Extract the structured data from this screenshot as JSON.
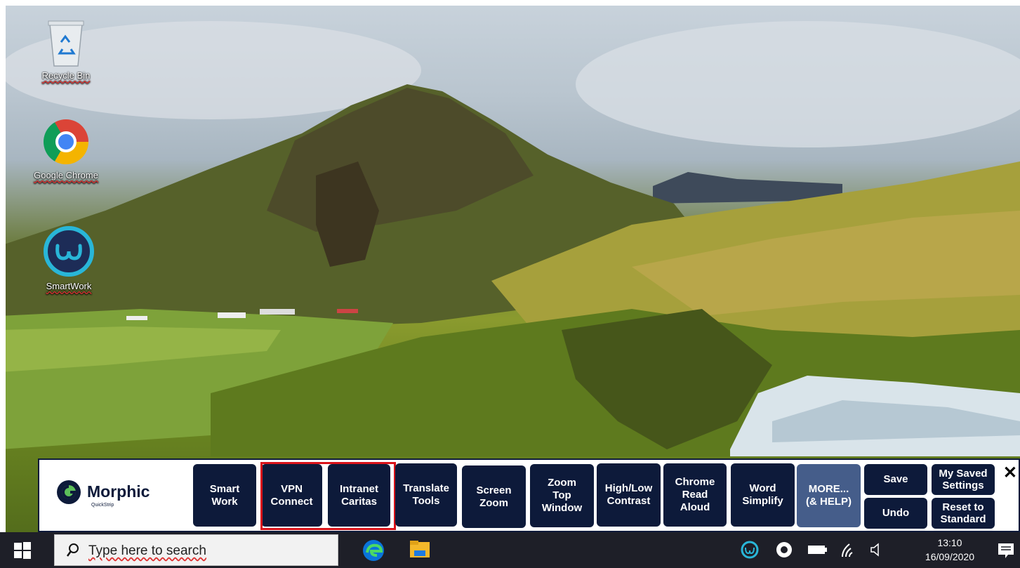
{
  "desktop": {
    "icons": [
      {
        "label": "Recycle Bin",
        "icon": "recycle-bin-icon"
      },
      {
        "label": "Google Chrome",
        "icon": "chrome-icon"
      },
      {
        "label": "SmartWork",
        "icon": "smartwork-icon"
      }
    ]
  },
  "quickstrip": {
    "logo_title": "Morphic",
    "logo_subtitle": "QuickStrip",
    "buttons": [
      {
        "label": "Smart\nWork"
      },
      {
        "label": "VPN\nConnect"
      },
      {
        "label": "Intranet\nCaritas"
      },
      {
        "label": "Translate\nTools"
      },
      {
        "label": "Screen\nZoom"
      },
      {
        "label": "Zoom\nTop\nWindow"
      },
      {
        "label": "High/Low\nContrast"
      },
      {
        "label": "Chrome\nRead\nAloud"
      },
      {
        "label": "Word\nSimplify"
      },
      {
        "label": "MORE...\n(& HELP)"
      },
      {
        "label": "Save"
      },
      {
        "label": "Undo"
      },
      {
        "label": "My Saved\nSettings"
      },
      {
        "label": "Reset to\nStandard"
      }
    ],
    "close_label": "✕",
    "highlight_color": "#d9131a"
  },
  "taskbar": {
    "search_placeholder": "Type here to search",
    "time": "13:10",
    "date": "16/09/2020",
    "colors": {
      "bar": "#1e1f28",
      "edge": "#0a74da",
      "files": "#f3b82b"
    }
  }
}
